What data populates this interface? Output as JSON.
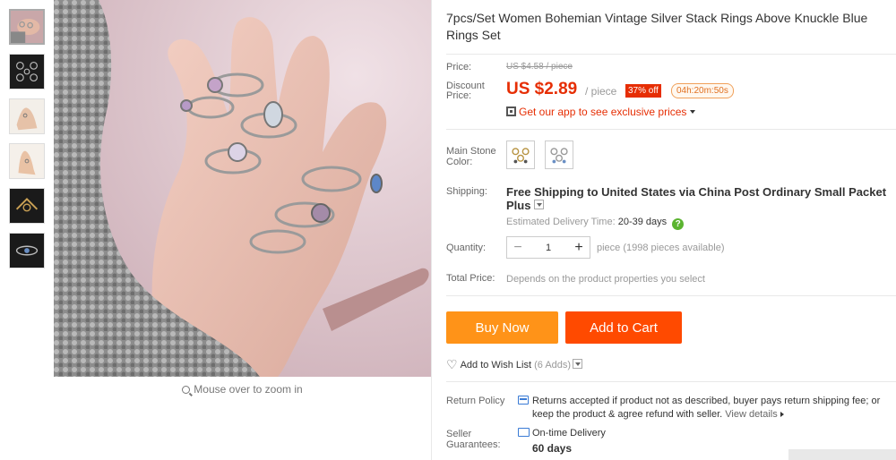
{
  "product": {
    "title": "7pcs/Set Women Bohemian Vintage Silver Stack Rings Above Knuckle Blue Rings Set"
  },
  "gallery": {
    "zoom_hint": "Mouse over to zoom in"
  },
  "price": {
    "label": "Price:",
    "original": "US $4.58 / piece",
    "discount_label_line1": "Discount",
    "discount_label_line2": "Price:",
    "current": "US $2.89",
    "per_unit": "/ piece",
    "discount_badge": "37% off",
    "countdown": "04h:20m:50s",
    "app_promo": "Get our app to see exclusive prices"
  },
  "options": {
    "label_line1": "Main Stone",
    "label_line2": "Color:"
  },
  "shipping": {
    "label": "Shipping:",
    "method_line1": "Free Shipping to United States via China Post Ordinary Small Packet",
    "method_line2": "Plus",
    "est_label": "Estimated Delivery Time:",
    "est_value": "20-39 days",
    "help": "?"
  },
  "quantity": {
    "label": "Quantity:",
    "value": "1",
    "minus": "−",
    "plus": "+",
    "note": "piece (1998 pieces available)"
  },
  "total": {
    "label": "Total Price:",
    "note": "Depends on the product properties you select"
  },
  "actions": {
    "buy_now": "Buy Now",
    "add_to_cart": "Add to Cart",
    "wishlist": "Add to Wish List",
    "wishlist_count": "(6 Adds)"
  },
  "policy": {
    "return_label": "Return Policy",
    "return_text": "Returns accepted if product not as described, buyer pays return shipping fee; or keep the product & agree refund with seller.",
    "view_details": "View details",
    "seller_label_line1": "Seller",
    "seller_label_line2": "Guarantees:",
    "ontime": "On-time Delivery",
    "ontime_days": "60 days"
  },
  "colors": {
    "price_red": "#e62e04",
    "buy_orange": "#ff9318",
    "cart_orange": "#ff4a00",
    "help_green": "#5bb430"
  }
}
